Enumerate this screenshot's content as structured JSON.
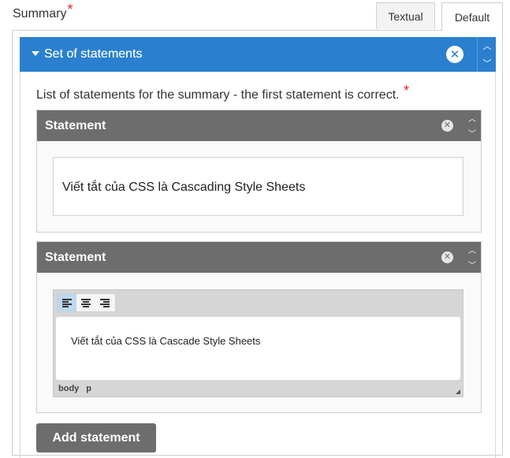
{
  "field": {
    "label": "Summary",
    "required_mark": "*"
  },
  "tabs": [
    {
      "label": "Textual",
      "active": false
    },
    {
      "label": "Default",
      "active": true
    }
  ],
  "group": {
    "title": "Set of statements",
    "close_icon": "close-icon",
    "description": "List of statements for the summary - the first statement is correct.",
    "description_required_mark": "*"
  },
  "statements": [
    {
      "title": "Statement",
      "value": "Viết tắt của CSS là Cascading Style Sheets"
    },
    {
      "title": "Statement",
      "value": "Viết tắt của CSS là Cascade Style Sheets",
      "editor": {
        "status_path": [
          "body",
          "p"
        ]
      }
    }
  ],
  "add_button": {
    "label": "Add statement"
  },
  "colors": {
    "group_header": "#2a80cf",
    "statement_header": "#6e6d6e",
    "required": "#d9262c"
  }
}
